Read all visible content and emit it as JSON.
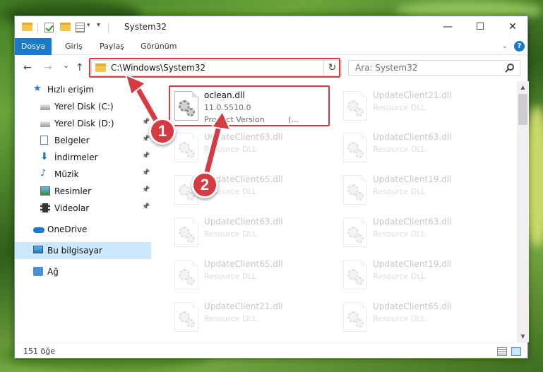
{
  "window": {
    "title": "System32",
    "minimize_glyph": "—",
    "maximize_glyph": "☐",
    "close_glyph": "✕"
  },
  "ribbon": {
    "tabs": [
      {
        "label": "Dosya"
      },
      {
        "label": "Giriş"
      },
      {
        "label": "Paylaş"
      },
      {
        "label": "Görünüm"
      }
    ],
    "help_label": "?"
  },
  "navigation": {
    "back_glyph": "←",
    "forward_glyph": "→",
    "recent_glyph": "⌄",
    "up_glyph": "↑",
    "address": "C:\\Windows\\System32",
    "refresh_glyph": "↻",
    "search_placeholder": "Ara: System32"
  },
  "sidebar": {
    "items": [
      {
        "label": "Hızlı erişim",
        "icon": "star-icon",
        "pinned": false
      },
      {
        "label": "Yerel Disk (C:)",
        "icon": "drive-icon",
        "pinned": true
      },
      {
        "label": "Yerel Disk (D:)",
        "icon": "drive-icon",
        "pinned": true
      },
      {
        "label": "Belgeler",
        "icon": "documents-icon",
        "pinned": true
      },
      {
        "label": "İndirmeler",
        "icon": "download-icon",
        "pinned": true
      },
      {
        "label": "Müzik",
        "icon": "music-icon",
        "pinned": true
      },
      {
        "label": "Resimler",
        "icon": "pictures-icon",
        "pinned": true
      },
      {
        "label": "Videolar",
        "icon": "videos-icon",
        "pinned": true
      },
      {
        "label": "OneDrive",
        "icon": "cloud-icon",
        "pinned": false
      },
      {
        "label": "Bu bilgisayar",
        "icon": "computer-icon",
        "pinned": false,
        "selected": true
      },
      {
        "label": "Ağ",
        "icon": "network-icon",
        "pinned": false
      }
    ],
    "pin_glyph": "📌"
  },
  "files": {
    "highlighted": {
      "name": "oclean.dll",
      "version": "11.0.5510.0",
      "description": "Product Version",
      "description_suffix": "(..."
    },
    "rows": [
      [
        "UpdateClient21.dll",
        "Resource DLL"
      ],
      [
        "UpdateClient63.dll",
        "Resource DLL"
      ],
      [
        "UpdateClient63.dll",
        "Resource DLL"
      ],
      [
        "UpdateClient65.dll",
        "Resource DLL"
      ],
      [
        "UpdateClient19.dll",
        "Resource DLL"
      ],
      [
        "UpdateClient63.dll",
        "Resource DLL"
      ],
      [
        "UpdateClient63.dll",
        "Resource DLL"
      ],
      [
        "UpdateClient65.dll",
        "Resource DLL"
      ],
      [
        "UpdateClient19.dll",
        "Resource DLL"
      ],
      [
        "UpdateClient21.dll",
        "Resource DLL"
      ],
      [
        "UpdateClient65.dll",
        "Resource DLL"
      ]
    ]
  },
  "status": {
    "count_text": "151 öğe"
  },
  "callouts": {
    "one": "1",
    "two": "2"
  },
  "colors": {
    "accent": "#1979ca",
    "highlight": "#d63b44",
    "selected_bg": "#cce8ff"
  }
}
